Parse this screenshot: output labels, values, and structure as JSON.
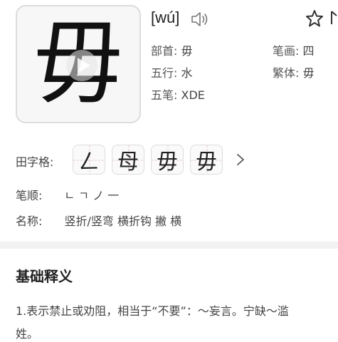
{
  "character": "毋",
  "pinyin": "[wú]",
  "info": {
    "radical_label": "部首:",
    "radical_value": "毋",
    "strokes_label": "笔画:",
    "strokes_value": "四",
    "element_label": "五行:",
    "element_value": "水",
    "traditional_label": "繁体:",
    "traditional_value": "毋",
    "wubi_label": "五笔:",
    "wubi_value": "XDE"
  },
  "grid_row": {
    "label": "田字格:",
    "steps": [
      "ㄥ",
      "母",
      "毋",
      "毋"
    ]
  },
  "stroke_order": {
    "label": "笔顺:",
    "value": "ㄴ ㄱ ノ 一"
  },
  "stroke_names": {
    "label": "名称:",
    "value": "竖折/竖弯 横折钩 撇 横"
  },
  "definition": {
    "heading": "基础释义",
    "line1": "1.表示禁止或劝阻，相当于“不要”：～妄言。宁缺～滥",
    "line2": "姓。"
  },
  "icons": {
    "play": "play-icon",
    "speaker": "speaker-icon",
    "star": "star-icon",
    "chevron": "chevron-right-icon"
  }
}
